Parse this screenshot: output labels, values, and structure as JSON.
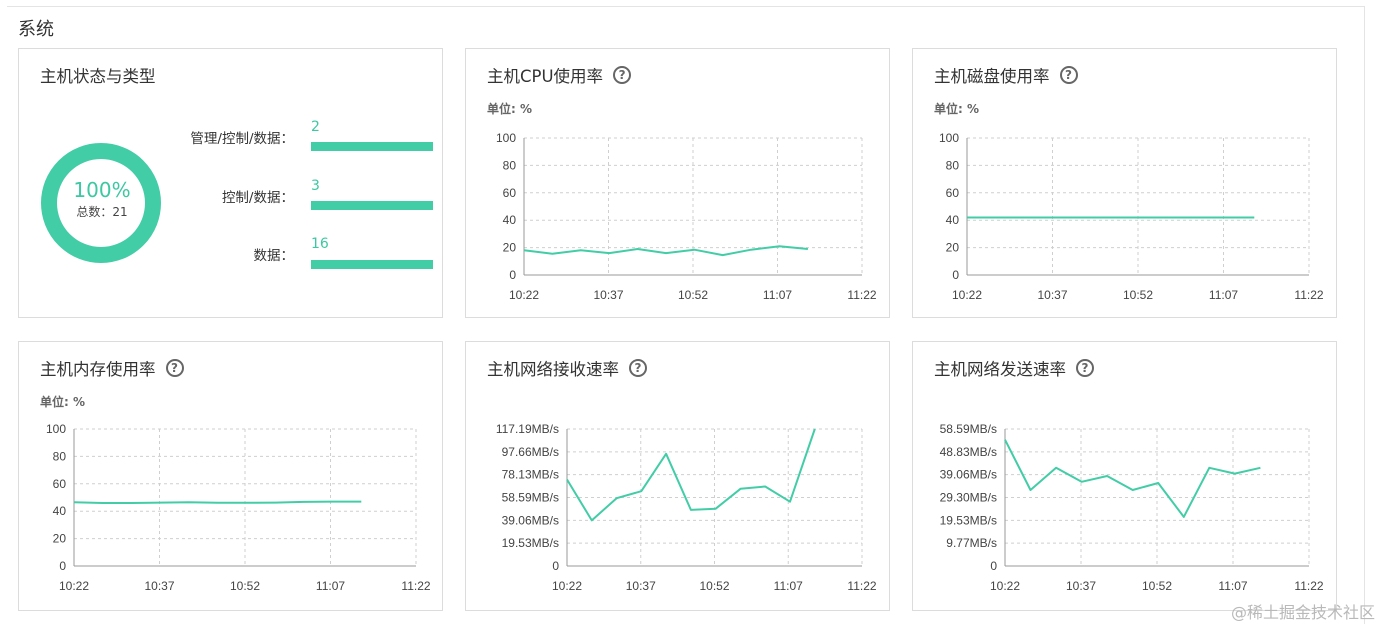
{
  "section_title": "系统",
  "status_card": {
    "title": "主机状态与类型",
    "donut_percent": "100%",
    "donut_total_label": "总数：",
    "donut_total_value": "21",
    "rows": [
      {
        "label": "管理/控制/数据：",
        "count": "2"
      },
      {
        "label": "控制/数据：",
        "count": "3"
      },
      {
        "label": "数据：",
        "count": "16"
      }
    ]
  },
  "colors": {
    "accent": "#42cda6",
    "grid": "#cfcfcf"
  },
  "help_icon": "question-circle-icon",
  "watermark": "@稀土掘金技术社区",
  "chart_data": [
    {
      "id": "cpu",
      "type": "line",
      "title": "主机CPU使用率",
      "unit_label": "单位: %",
      "x_ticks": [
        "10:22",
        "10:37",
        "10:52",
        "11:07",
        "11:22"
      ],
      "y_ticks": [
        "0",
        "20",
        "40",
        "60",
        "80",
        "100"
      ],
      "ylim": [
        0,
        100
      ],
      "x": [
        "10:22",
        "10:28",
        "10:34",
        "10:40",
        "10:46",
        "10:52",
        "10:58",
        "11:04",
        "11:10",
        "11:16"
      ],
      "values": [
        18,
        15.5,
        18,
        16,
        19,
        16,
        18.5,
        14.5,
        18.5,
        21,
        19
      ]
    },
    {
      "id": "disk",
      "type": "line",
      "title": "主机磁盘使用率",
      "unit_label": "单位: %",
      "x_ticks": [
        "10:22",
        "10:37",
        "10:52",
        "11:07",
        "11:22"
      ],
      "y_ticks": [
        "0",
        "20",
        "40",
        "60",
        "80",
        "100"
      ],
      "ylim": [
        0,
        100
      ],
      "values": [
        42,
        42,
        42,
        42,
        42,
        42,
        42,
        42,
        42,
        42,
        42
      ]
    },
    {
      "id": "memory",
      "type": "line",
      "title": "主机内存使用率",
      "unit_label": "单位: %",
      "x_ticks": [
        "10:22",
        "10:37",
        "10:52",
        "11:07",
        "11:22"
      ],
      "y_ticks": [
        "0",
        "20",
        "40",
        "60",
        "80",
        "100"
      ],
      "ylim": [
        0,
        100
      ],
      "values": [
        46.5,
        46,
        46,
        46.3,
        46.5,
        46.2,
        46.1,
        46.3,
        46.8,
        47,
        47
      ]
    },
    {
      "id": "net-recv",
      "type": "line",
      "title": "主机网络接收速率",
      "x_ticks": [
        "10:22",
        "10:37",
        "10:52",
        "11:07",
        "11:22"
      ],
      "y_ticks": [
        "0",
        "19.53MB/s",
        "39.06MB/s",
        "58.59MB/s",
        "78.13MB/s",
        "97.66MB/s",
        "117.19MB/s"
      ],
      "ylim": [
        0,
        117.19
      ],
      "values": [
        74,
        39,
        58,
        64,
        96,
        48,
        49,
        66,
        68,
        55,
        117.19
      ]
    },
    {
      "id": "net-send",
      "type": "line",
      "title": "主机网络发送速率",
      "x_ticks": [
        "10:22",
        "10:37",
        "10:52",
        "11:07",
        "11:22"
      ],
      "y_ticks": [
        "0",
        "9.77MB/s",
        "19.53MB/s",
        "29.30MB/s",
        "39.06MB/s",
        "48.83MB/s",
        "58.59MB/s"
      ],
      "ylim": [
        0,
        58.59
      ],
      "values": [
        54,
        32.5,
        42,
        36,
        38.5,
        32.5,
        35.5,
        21,
        42,
        39.5,
        42
      ]
    }
  ]
}
